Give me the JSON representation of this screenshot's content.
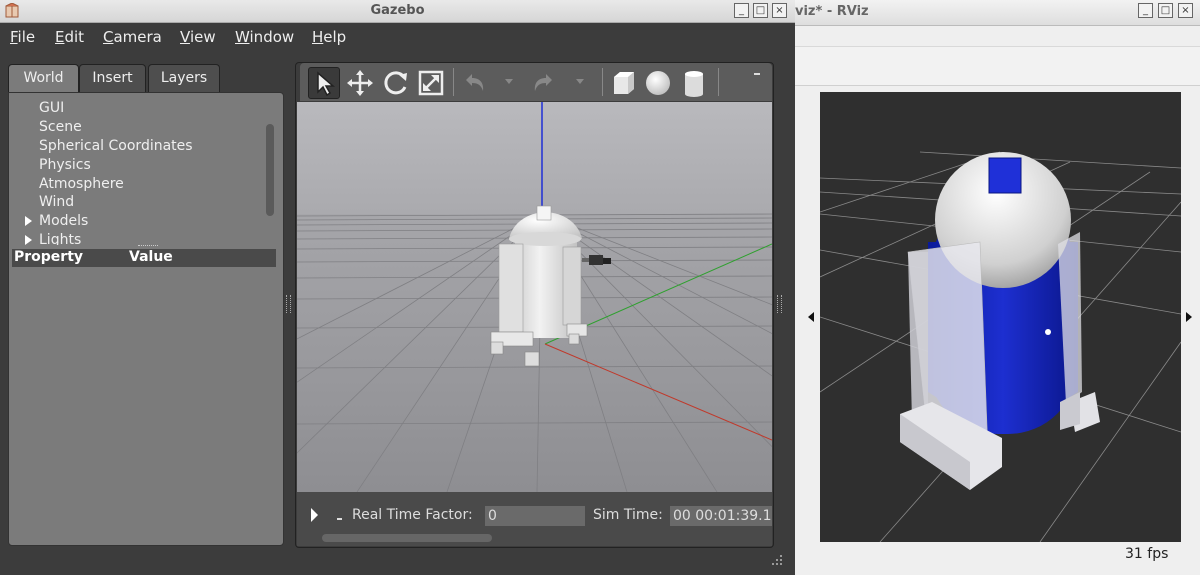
{
  "gazebo": {
    "title": "Gazebo",
    "menu": [
      "File",
      "Edit",
      "Camera",
      "View",
      "Window",
      "Help"
    ],
    "menu_underline": [
      "F",
      "E",
      "C",
      "V",
      "W",
      "H"
    ],
    "tabs": [
      "World",
      "Insert",
      "Layers"
    ],
    "tree": [
      "GUI",
      "Scene",
      "Spherical Coordinates",
      "Physics",
      "Atmosphere",
      "Wind",
      "Models",
      "Lights"
    ],
    "property_header": "Property",
    "value_header": "Value",
    "toolbar_icons": [
      "select-arrow-icon",
      "translate-icon",
      "rotate-icon",
      "scale-icon",
      "undo-icon",
      "redo-icon",
      "box-icon",
      "sphere-icon",
      "cylinder-icon"
    ],
    "bottom": {
      "rtf_label": "Real Time Factor:",
      "rtf_value": "0",
      "sim_time_label": "Sim Time:",
      "sim_time_value": "00 00:01:39.1"
    },
    "window_buttons": [
      "_",
      "□",
      "×"
    ]
  },
  "rviz": {
    "title": "viz* - RViz",
    "fps": "31 fps",
    "window_buttons": [
      "_",
      "□",
      "×"
    ]
  }
}
